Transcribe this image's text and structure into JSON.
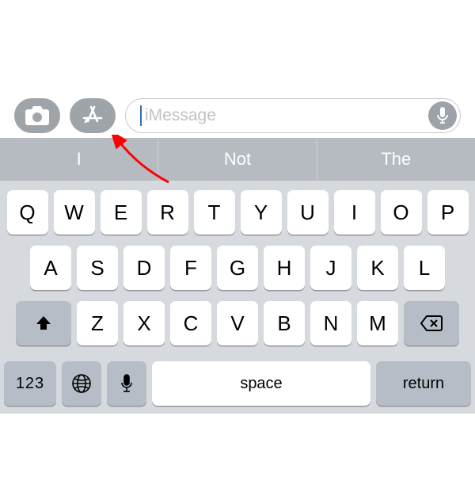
{
  "input_row": {
    "placeholder": "iMessage"
  },
  "suggestions": [
    "I",
    "Not",
    "The"
  ],
  "rows": {
    "r1": [
      "Q",
      "W",
      "E",
      "R",
      "T",
      "Y",
      "U",
      "I",
      "O",
      "P"
    ],
    "r2": [
      "A",
      "S",
      "D",
      "F",
      "G",
      "H",
      "J",
      "K",
      "L"
    ],
    "r3": [
      "Z",
      "X",
      "C",
      "V",
      "B",
      "N",
      "M"
    ]
  },
  "bottom": {
    "numbers": "123",
    "space": "space",
    "return": "return"
  }
}
